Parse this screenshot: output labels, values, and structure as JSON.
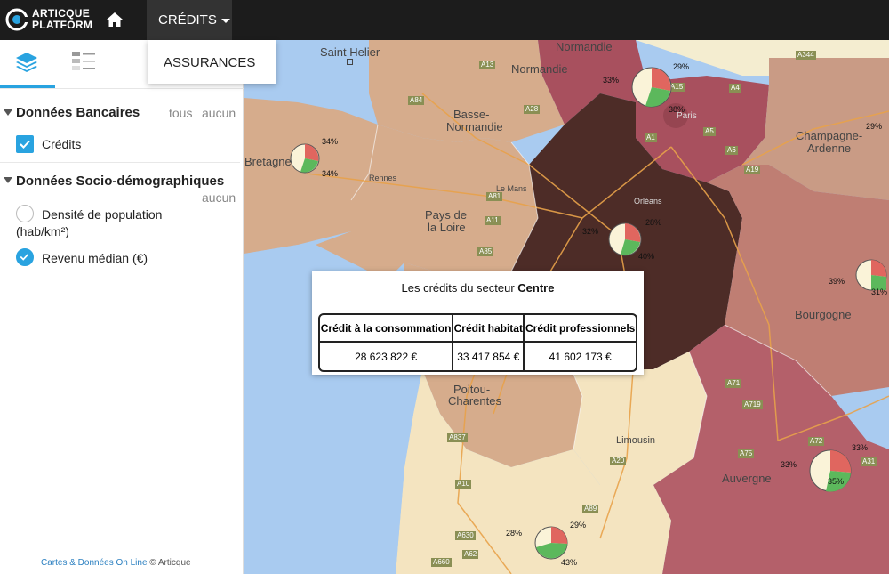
{
  "topbar": {
    "logo_line1": "ARTICQUE",
    "logo_line2": "PLATFORM",
    "home_icon": "home-icon",
    "menu_credits": "CRÉDITS",
    "dropdown_item": "ASSURANCES"
  },
  "sidebar": {
    "tabs": [
      "layers-icon",
      "legend-list-icon"
    ],
    "group1": {
      "title": "Données Bancaires",
      "select_all": "tous",
      "select_none": "aucun",
      "items": [
        {
          "label": "Crédits",
          "checked": true
        }
      ]
    },
    "group2": {
      "title": "Données Socio-démographiques",
      "select_none": "aucun",
      "items": [
        {
          "label_line1": "Densité de population",
          "label_line2": "(hab/km²)",
          "selected": false
        },
        {
          "label": "Revenu médian (€)",
          "selected": true
        }
      ]
    },
    "footer_link": "Cartes & Données On Line",
    "footer_copy": "© Articque"
  },
  "map": {
    "labels": {
      "saint_helier": "Saint Helier",
      "normandie_top": "Normandie",
      "normandie": "Normandie",
      "basse_normandie_1": "Basse-",
      "basse_normandie_2": "Normandie",
      "bretagne": "Bretagne",
      "rennes": "Rennes",
      "le_mans": "Le Mans",
      "pays_loire_1": "Pays de",
      "pays_loire_2": "la Loire",
      "orleans": "Orléans",
      "paris": "Paris",
      "champagne_1": "Champagne-",
      "champagne_2": "Ardenne",
      "bourgogne": "Bourgogne",
      "poitou_1": "Poitou-",
      "poitou_2": "Charentes",
      "limousin": "Limousin",
      "auvergne": "Auvergne"
    },
    "roads": [
      "A13",
      "A84",
      "A28",
      "A11",
      "A81",
      "A85",
      "A344",
      "A19",
      "A15",
      "A5",
      "A6",
      "A1",
      "A4",
      "A71",
      "A719",
      "A89",
      "A75",
      "A72",
      "A837",
      "A20",
      "A10",
      "A630",
      "A62",
      "A660",
      "A31"
    ],
    "pies": {
      "paris": [
        "33%",
        "29%",
        "38%"
      ],
      "bretagne": [
        "34%",
        "34%"
      ],
      "centre": [
        "32%",
        "28%",
        "40%"
      ],
      "champagne": [
        "29%"
      ],
      "bourgogne": [
        "39%",
        "31%"
      ],
      "auvergne": [
        "33%",
        "33%",
        "35%"
      ],
      "aquitaine": [
        "28%",
        "29%",
        "43%"
      ]
    },
    "colors": {
      "pie_red": "#e0665f",
      "pie_green": "#5cb85c",
      "pie_cream": "#faf3d8",
      "sea": "#a9cbf0"
    }
  },
  "popup": {
    "title_prefix": "Les crédits du secteur ",
    "title_region": "Centre",
    "columns": [
      "Crédit à la consommation",
      "Crédit habitat",
      "Crédit professionnels"
    ],
    "values": [
      "28 623 822 €",
      "33 417 854 €",
      "41 602 173 €"
    ]
  }
}
